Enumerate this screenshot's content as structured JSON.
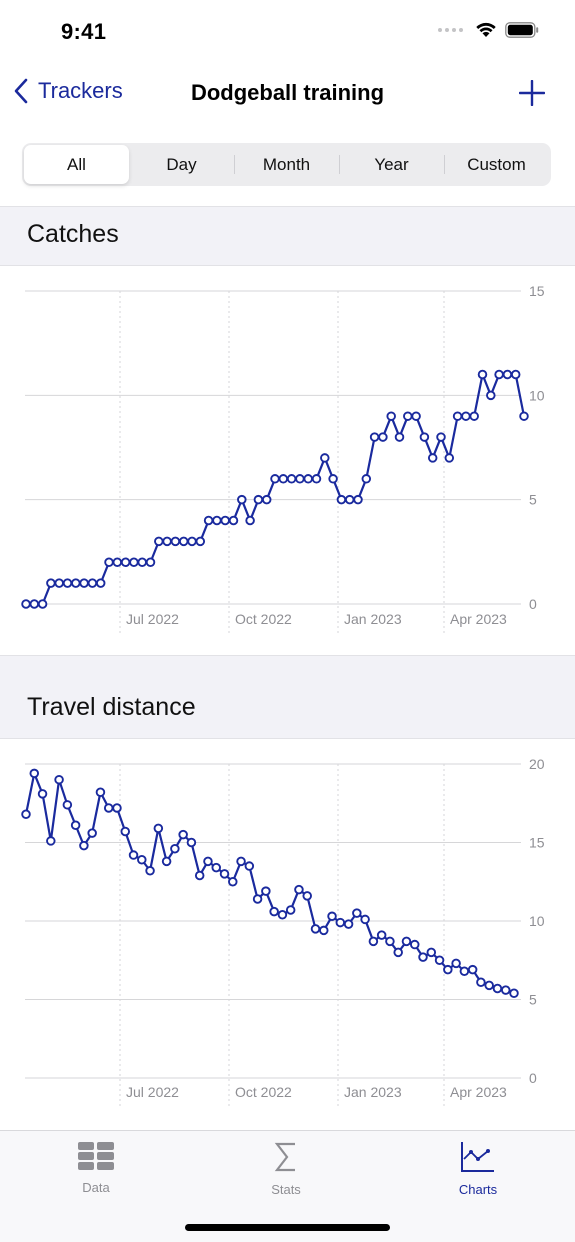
{
  "status_bar": {
    "time": "9:41",
    "icons": [
      "signal-dots-icon",
      "wifi-icon",
      "battery-icon"
    ]
  },
  "nav": {
    "back_label": "Trackers",
    "title": "Dodgeball training",
    "add_icon": "plus-icon"
  },
  "segments": {
    "selected": "All",
    "items": [
      {
        "label": "All"
      },
      {
        "label": "Day"
      },
      {
        "label": "Month"
      },
      {
        "label": "Year"
      },
      {
        "label": "Custom"
      }
    ]
  },
  "sections": [
    {
      "title": "Catches"
    },
    {
      "title": "Travel distance"
    }
  ],
  "colors": {
    "accent": "#1b2a9c",
    "line": "#1a2a9e",
    "grid": "#d6d6d8",
    "axis_label": "#8e8e93",
    "section_bg": "#f2f2f7"
  },
  "chart_data": [
    {
      "type": "line",
      "title": "Catches",
      "xlabel": "",
      "ylabel": "",
      "x_tick_labels": [
        "Jul 2022",
        "Oct 2022",
        "Jan 2023",
        "Apr 2023"
      ],
      "y_ticks": [
        0,
        5,
        10,
        15
      ],
      "ylim": [
        0,
        15
      ],
      "grid": true,
      "y_axis_side": "right",
      "series": [
        {
          "name": "Catches",
          "values": [
            0,
            0,
            0,
            1,
            1,
            1,
            1,
            1,
            1,
            1,
            2,
            2,
            2,
            2,
            2,
            2,
            3,
            3,
            3,
            3,
            3,
            3,
            4,
            4,
            4,
            4,
            5,
            4,
            5,
            5,
            6,
            6,
            6,
            6,
            6,
            6,
            7,
            6,
            5,
            5,
            5,
            6,
            8,
            8,
            9,
            8,
            9,
            9,
            8,
            7,
            8,
            7,
            9,
            9,
            9,
            11,
            10,
            11,
            11,
            11,
            9
          ]
        }
      ]
    },
    {
      "type": "line",
      "title": "Travel distance",
      "xlabel": "",
      "ylabel": "",
      "x_tick_labels": [
        "Jul 2022",
        "Oct 2022",
        "Jan 2023",
        "Apr 2023"
      ],
      "y_ticks": [
        0,
        5,
        10,
        15,
        20
      ],
      "ylim": [
        0,
        20
      ],
      "grid": true,
      "y_axis_side": "right",
      "series": [
        {
          "name": "Travel distance",
          "values": [
            16.8,
            19.4,
            18.1,
            15.1,
            19.0,
            17.4,
            16.1,
            14.8,
            15.6,
            18.2,
            17.2,
            17.2,
            15.7,
            14.2,
            13.9,
            13.2,
            15.9,
            13.8,
            14.6,
            15.5,
            15.0,
            12.9,
            13.8,
            13.4,
            13.0,
            12.5,
            13.8,
            13.5,
            11.4,
            11.9,
            10.6,
            10.4,
            10.7,
            12.0,
            11.6,
            9.5,
            9.4,
            10.3,
            9.9,
            9.8,
            10.5,
            10.1,
            8.7,
            9.1,
            8.7,
            8.0,
            8.7,
            8.5,
            7.7,
            8.0,
            7.5,
            6.9,
            7.3,
            6.8,
            6.9,
            6.1,
            5.9,
            5.7,
            5.6,
            5.4
          ]
        }
      ]
    }
  ],
  "tab_bar": {
    "items": [
      {
        "label": "Data",
        "icon": "table-icon",
        "active": false
      },
      {
        "label": "Stats",
        "icon": "sigma-icon",
        "active": false
      },
      {
        "label": "Charts",
        "icon": "line-chart-icon",
        "active": true
      }
    ]
  }
}
